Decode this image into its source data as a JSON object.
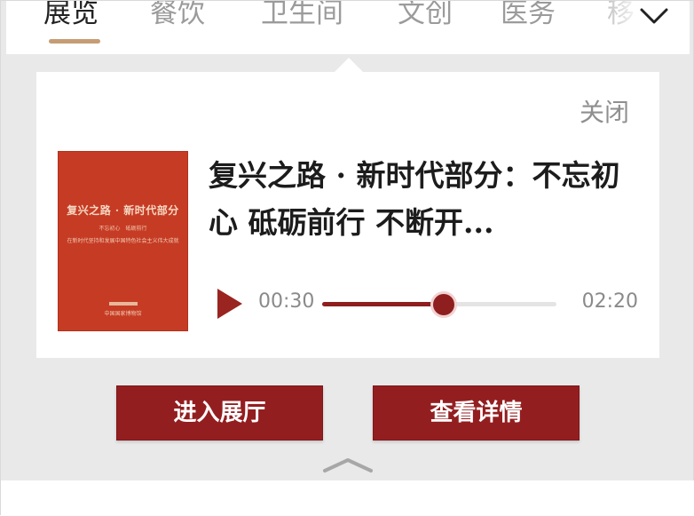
{
  "tabs": [
    {
      "label": "展览",
      "active": true
    },
    {
      "label": "餐饮",
      "active": false
    },
    {
      "label": "卫生间",
      "active": false
    },
    {
      "label": "文创",
      "active": false
    },
    {
      "label": "医务",
      "active": false
    },
    {
      "label": "移",
      "active": false
    }
  ],
  "panel": {
    "close_label": "关闭",
    "title": "复兴之路 · 新时代部分：不忘初心 砥砺前行 不断开...",
    "cover": {
      "title": "复兴之路 · 新时代部分",
      "line1": "不忘初心　砥砺前行",
      "line2": "在新时代坚持和发展中国特色社会主义伟大成就",
      "publisher": "中国国家博物馆"
    },
    "player": {
      "current_time": "00:30",
      "total_time": "02:20",
      "progress": 0.52
    },
    "buttons": {
      "enter_hall": "进入展厅",
      "view_details": "查看详情"
    }
  },
  "colors": {
    "accent": "#931e20",
    "tab_underline": "#c59d74",
    "cover": "#c63b24"
  },
  "icons": {
    "more": "chevron-down-icon",
    "play": "play-icon",
    "collapse": "chevron-up-icon"
  }
}
